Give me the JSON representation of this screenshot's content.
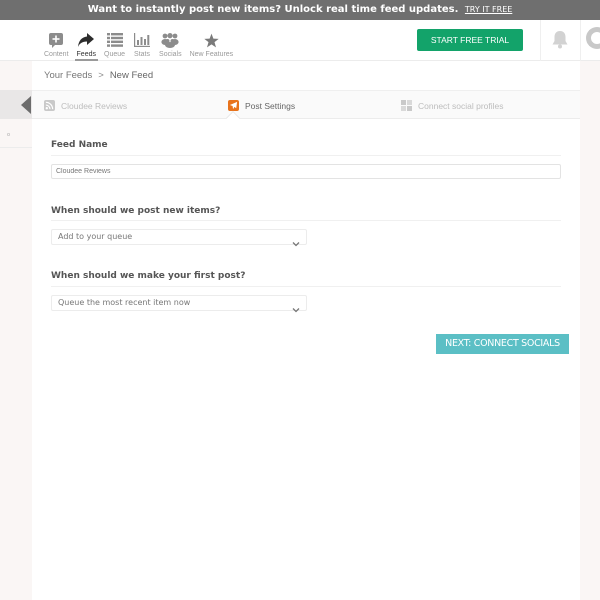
{
  "promo": {
    "message": "Want to instantly post new items? Unlock real time feed updates.",
    "cta": "TRY IT FREE"
  },
  "nav": {
    "items": [
      {
        "label": "Content",
        "icon": "content-plus-icon",
        "active": false
      },
      {
        "label": "Feeds",
        "icon": "share-arrow-icon",
        "active": true
      },
      {
        "label": "Queue",
        "icon": "list-icon",
        "active": false
      },
      {
        "label": "Stats",
        "icon": "bar-chart-icon",
        "active": false
      },
      {
        "label": "Socials",
        "icon": "people-icon",
        "active": false
      },
      {
        "label": "New Features",
        "icon": "star-icon",
        "active": false
      }
    ],
    "trial_button": "START FREE TRIAL",
    "bell_icon": "bell-icon",
    "avatar_icon": "avatar-icon"
  },
  "breadcrumb": {
    "parent": "Your Feeds",
    "separator": ">",
    "current": "New Feed"
  },
  "steps": [
    {
      "label": "Cloudee Reviews",
      "icon": "rss-icon",
      "state": "done"
    },
    {
      "label": "Post Settings",
      "icon": "paper-plane-icon",
      "state": "active"
    },
    {
      "label": "Connect social profiles",
      "icon": "social-grid-icon",
      "state": "pending"
    }
  ],
  "form": {
    "feed_name": {
      "label": "Feed Name",
      "value": "Cloudee Reviews"
    },
    "post_new_items": {
      "label": "When should we post new items?",
      "selected": "Add to your queue"
    },
    "first_post": {
      "label": "When should we make your first post?",
      "selected": "Queue the most recent item now"
    },
    "next_button": "NEXT: CONNECT SOCIALS"
  },
  "colors": {
    "promo_bg": "#6f6f6f",
    "trial_green": "#13a36a",
    "next_teal": "#5bbfc5",
    "step_active_orange": "#e8731c"
  }
}
